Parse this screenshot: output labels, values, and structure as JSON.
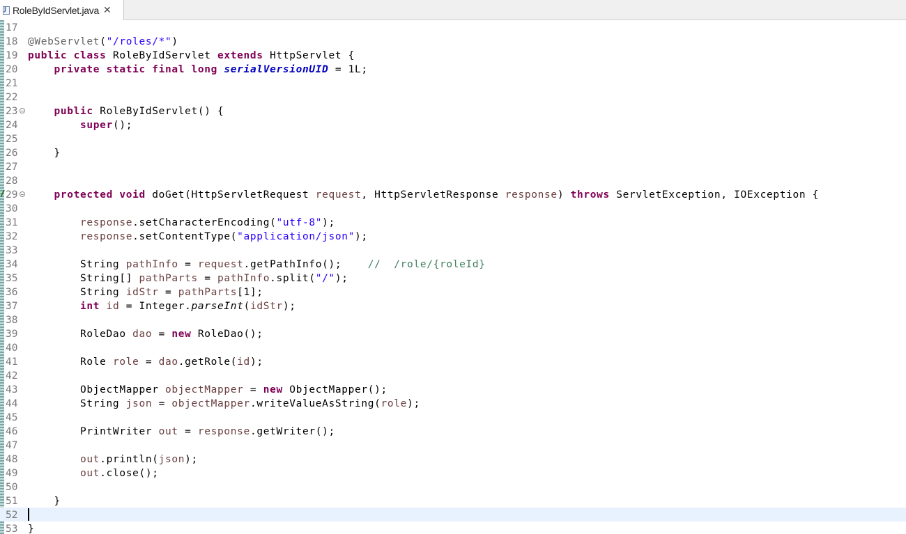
{
  "tab": {
    "label": "RoleByIdServlet.java",
    "close": "✕"
  },
  "editor": {
    "lines": [
      {
        "n": "17",
        "t": []
      },
      {
        "n": "18",
        "t": [
          [
            "ann",
            "@WebServlet"
          ],
          [
            "",
            "("
          ],
          [
            "str",
            "\"/roles/*\""
          ],
          [
            "",
            ")"
          ]
        ]
      },
      {
        "n": "19",
        "t": [
          [
            "kw",
            "public class"
          ],
          [
            "",
            " RoleByIdServlet "
          ],
          [
            "kw",
            "extends"
          ],
          [
            "",
            " HttpServlet {"
          ]
        ]
      },
      {
        "n": "20",
        "t": [
          [
            "",
            "    "
          ],
          [
            "kw",
            "private static final long"
          ],
          [
            "",
            " "
          ],
          [
            "field",
            "serialVersionUID"
          ],
          [
            "",
            " = 1L;"
          ]
        ]
      },
      {
        "n": "21",
        "t": []
      },
      {
        "n": "22",
        "t": []
      },
      {
        "n": "23",
        "fold": true,
        "t": [
          [
            "",
            "    "
          ],
          [
            "kw",
            "public"
          ],
          [
            "",
            " RoleByIdServlet() {"
          ]
        ]
      },
      {
        "n": "24",
        "t": [
          [
            "",
            "        "
          ],
          [
            "kw",
            "super"
          ],
          [
            "",
            "();"
          ]
        ]
      },
      {
        "n": "25",
        "t": []
      },
      {
        "n": "26",
        "t": [
          [
            "",
            "    }"
          ]
        ]
      },
      {
        "n": "27",
        "t": []
      },
      {
        "n": "28",
        "t": []
      },
      {
        "n": "29",
        "fold": true,
        "mark": true,
        "t": [
          [
            "",
            "    "
          ],
          [
            "kw",
            "protected void"
          ],
          [
            "",
            " doGet(HttpServletRequest "
          ],
          [
            "var",
            "request"
          ],
          [
            "",
            ", HttpServletResponse "
          ],
          [
            "var",
            "response"
          ],
          [
            "",
            ") "
          ],
          [
            "kw",
            "throws"
          ],
          [
            "",
            " ServletException, IOException {"
          ]
        ]
      },
      {
        "n": "30",
        "t": []
      },
      {
        "n": "31",
        "t": [
          [
            "",
            "        "
          ],
          [
            "var",
            "response"
          ],
          [
            "",
            ".setCharacterEncoding("
          ],
          [
            "str",
            "\"utf-8\""
          ],
          [
            "",
            ");"
          ]
        ]
      },
      {
        "n": "32",
        "t": [
          [
            "",
            "        "
          ],
          [
            "var",
            "response"
          ],
          [
            "",
            ".setContentType("
          ],
          [
            "str",
            "\"application/json\""
          ],
          [
            "",
            ");"
          ]
        ]
      },
      {
        "n": "33",
        "t": []
      },
      {
        "n": "34",
        "t": [
          [
            "",
            "        String "
          ],
          [
            "var",
            "pathInfo"
          ],
          [
            "",
            " = "
          ],
          [
            "var",
            "request"
          ],
          [
            "",
            ".getPathInfo();    "
          ],
          [
            "cmt",
            "//  /role/{roleId}"
          ]
        ]
      },
      {
        "n": "35",
        "t": [
          [
            "",
            "        String[] "
          ],
          [
            "var",
            "pathParts"
          ],
          [
            "",
            " = "
          ],
          [
            "var",
            "pathInfo"
          ],
          [
            "",
            ".split("
          ],
          [
            "str",
            "\"/\""
          ],
          [
            "",
            ");"
          ]
        ]
      },
      {
        "n": "36",
        "t": [
          [
            "",
            "        String "
          ],
          [
            "var",
            "idStr"
          ],
          [
            "",
            " = "
          ],
          [
            "var",
            "pathParts"
          ],
          [
            "",
            "[1];"
          ]
        ]
      },
      {
        "n": "37",
        "t": [
          [
            "",
            "        "
          ],
          [
            "kw",
            "int"
          ],
          [
            "",
            " "
          ],
          [
            "var",
            "id"
          ],
          [
            "",
            " = Integer."
          ],
          [
            "it",
            "parseInt"
          ],
          [
            "",
            "("
          ],
          [
            "var",
            "idStr"
          ],
          [
            "",
            ");"
          ]
        ]
      },
      {
        "n": "38",
        "t": []
      },
      {
        "n": "39",
        "t": [
          [
            "",
            "        RoleDao "
          ],
          [
            "var",
            "dao"
          ],
          [
            "",
            " = "
          ],
          [
            "kw",
            "new"
          ],
          [
            "",
            " RoleDao();"
          ]
        ]
      },
      {
        "n": "40",
        "t": []
      },
      {
        "n": "41",
        "t": [
          [
            "",
            "        Role "
          ],
          [
            "var",
            "role"
          ],
          [
            "",
            " = "
          ],
          [
            "var",
            "dao"
          ],
          [
            "",
            ".getRole("
          ],
          [
            "var",
            "id"
          ],
          [
            "",
            ");"
          ]
        ]
      },
      {
        "n": "42",
        "t": []
      },
      {
        "n": "43",
        "t": [
          [
            "",
            "        ObjectMapper "
          ],
          [
            "var",
            "objectMapper"
          ],
          [
            "",
            " = "
          ],
          [
            "kw",
            "new"
          ],
          [
            "",
            " ObjectMapper();"
          ]
        ]
      },
      {
        "n": "44",
        "t": [
          [
            "",
            "        String "
          ],
          [
            "var",
            "json"
          ],
          [
            "",
            " = "
          ],
          [
            "var",
            "objectMapper"
          ],
          [
            "",
            ".writeValueAsString("
          ],
          [
            "var",
            "role"
          ],
          [
            "",
            ");"
          ]
        ]
      },
      {
        "n": "45",
        "t": []
      },
      {
        "n": "46",
        "t": [
          [
            "",
            "        PrintWriter "
          ],
          [
            "var",
            "out"
          ],
          [
            "",
            " = "
          ],
          [
            "var",
            "response"
          ],
          [
            "",
            ".getWriter();"
          ]
        ]
      },
      {
        "n": "47",
        "t": []
      },
      {
        "n": "48",
        "t": [
          [
            "",
            "        "
          ],
          [
            "var",
            "out"
          ],
          [
            "",
            ".println("
          ],
          [
            "var",
            "json"
          ],
          [
            "",
            ");"
          ]
        ]
      },
      {
        "n": "49",
        "t": [
          [
            "",
            "        "
          ],
          [
            "var",
            "out"
          ],
          [
            "",
            ".close();"
          ]
        ]
      },
      {
        "n": "50",
        "t": []
      },
      {
        "n": "51",
        "t": [
          [
            "",
            "    }"
          ]
        ]
      },
      {
        "n": "52",
        "current": true,
        "t": []
      },
      {
        "n": "53",
        "t": [
          [
            "",
            "}"
          ]
        ]
      }
    ]
  },
  "colors": {
    "keyword": "#7f0055",
    "string": "#2a00ff",
    "variable": "#6a3e3e",
    "field": "#0000c0",
    "comment": "#3f7f5f",
    "annotation": "#646464",
    "current_line": "#e8f2fe"
  }
}
